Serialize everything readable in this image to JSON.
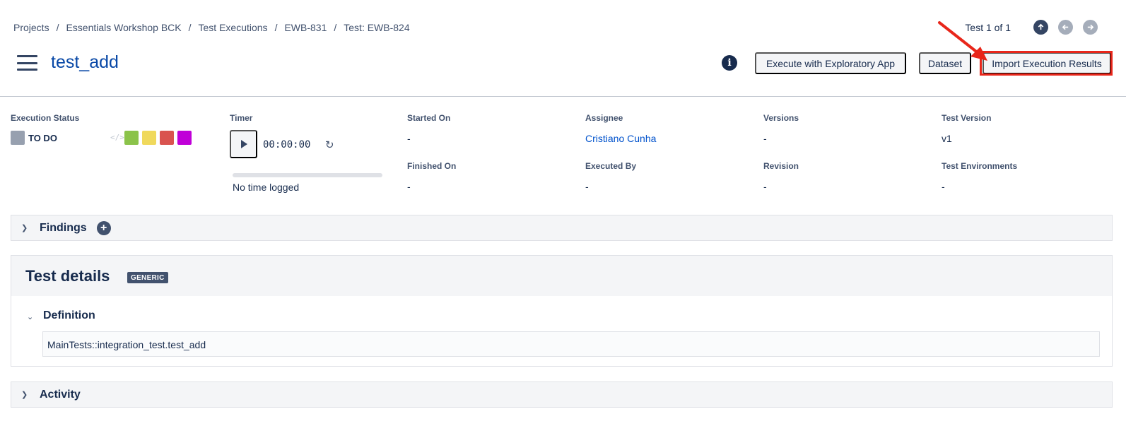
{
  "breadcrumb": [
    "Projects",
    "Essentials Workshop BCK",
    "Test Executions",
    "EWB-831",
    "Test: EWB-824"
  ],
  "pager": {
    "text": "Test 1 of 1"
  },
  "page_title": "test_add",
  "toolbar": {
    "explore_label": "Execute with Exploratory App",
    "dataset_label": "Dataset",
    "import_label": "Import Execution Results"
  },
  "execution_status": {
    "label": "Execution Status",
    "value": "TO DO",
    "code_glyph": "</>",
    "colors": [
      "#8bc34a",
      "#f0d95c",
      "#d9534f",
      "#c000d8"
    ]
  },
  "timer": {
    "label": "Timer",
    "time": "00:00:00",
    "log_text": "No time logged",
    "progress": 0
  },
  "fields": {
    "started_on": {
      "label": "Started On",
      "value": "-"
    },
    "finished_on": {
      "label": "Finished On",
      "value": "-"
    },
    "assignee": {
      "label": "Assignee",
      "value": "Cristiano Cunha"
    },
    "executed_by": {
      "label": "Executed By",
      "value": "-"
    },
    "versions": {
      "label": "Versions",
      "value": "-"
    },
    "revision": {
      "label": "Revision",
      "value": "-"
    },
    "test_version": {
      "label": "Test Version",
      "value": "v1"
    },
    "test_environments": {
      "label": "Test Environments",
      "value": "-"
    }
  },
  "findings": {
    "title": "Findings"
  },
  "test_details": {
    "title": "Test details",
    "badge": "GENERIC",
    "definition_title": "Definition",
    "definition_value": "MainTests::integration_test.test_add"
  },
  "activity": {
    "title": "Activity"
  },
  "colors": {
    "link": "#0052cc",
    "title": "#0747a6",
    "highlight": "#e8261a"
  }
}
